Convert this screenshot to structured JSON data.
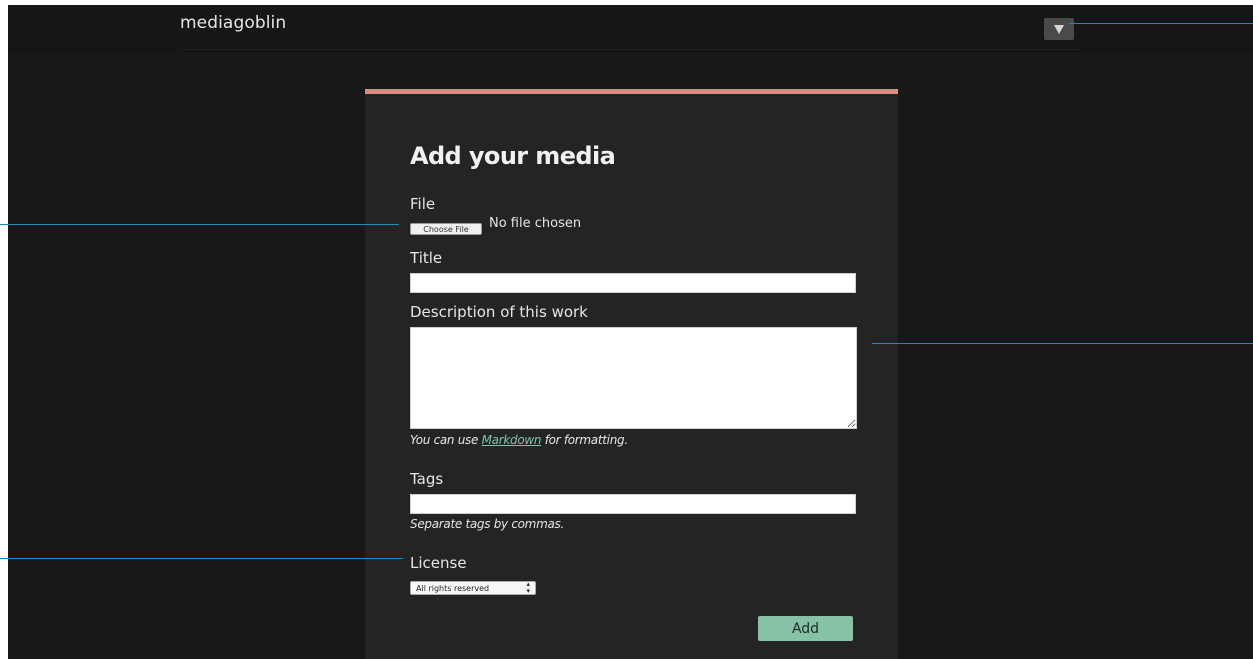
{
  "header": {
    "logo": "mediagoblin",
    "menu_icon": "chevron-down-icon"
  },
  "form": {
    "title": "Add your media",
    "file": {
      "label": "File",
      "button_label": "Choose File",
      "status": "No file chosen"
    },
    "title_field": {
      "label": "Title",
      "value": ""
    },
    "description": {
      "label": "Description of this work",
      "value": "",
      "help_prefix": "You can use ",
      "help_link": "Markdown",
      "help_suffix": " for formatting."
    },
    "tags": {
      "label": "Tags",
      "value": "",
      "help": "Separate tags by commas."
    },
    "license": {
      "label": "License",
      "selected": "All rights reserved"
    },
    "submit_label": "Add"
  },
  "colors": {
    "background": "#181818",
    "panel": "#242424",
    "accent_top_border": "#d88d83",
    "submit_button": "#86c3a6",
    "link": "#7ec6a9",
    "callout_line": "#1c8cc0"
  }
}
